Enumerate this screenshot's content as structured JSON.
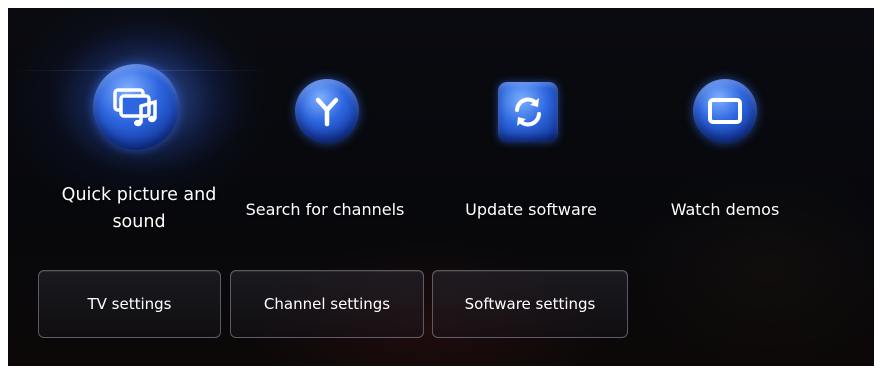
{
  "actions": [
    {
      "label": "Quick picture and sound",
      "icon": "picture-sound-icon"
    },
    {
      "label": "Search for channels",
      "icon": "antenna-icon"
    },
    {
      "label": "Update software",
      "icon": "refresh-icon"
    },
    {
      "label": "Watch demos",
      "icon": "screen-icon"
    }
  ],
  "settings_buttons": [
    {
      "label": "TV settings"
    },
    {
      "label": "Channel settings"
    },
    {
      "label": "Software settings"
    }
  ],
  "colors": {
    "accent": "#2e66e0",
    "background": "#07080c",
    "text": "#ffffff"
  }
}
